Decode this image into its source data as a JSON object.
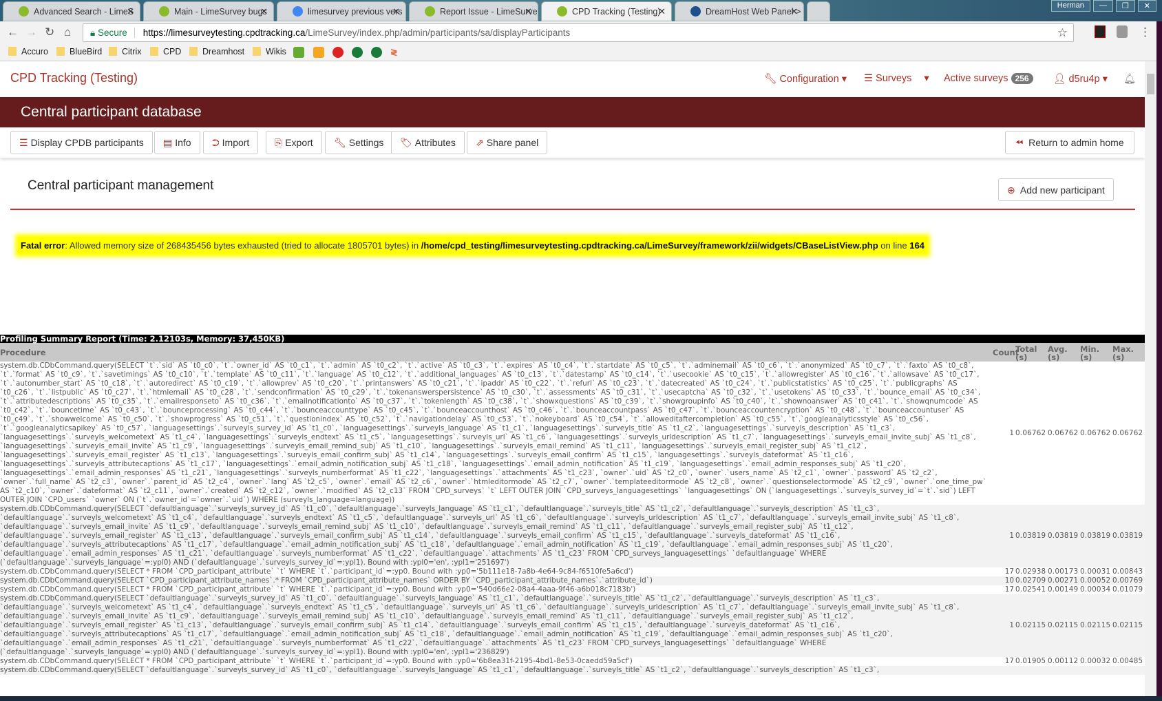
{
  "browser": {
    "tabs": [
      {
        "title": "Advanced Search - LimeS",
        "active": false
      },
      {
        "title": "Main - LimeSurvey bugs",
        "active": false
      },
      {
        "title": "limesurvey previous vers",
        "active": false
      },
      {
        "title": "Report Issue - LimeSurve",
        "active": false
      },
      {
        "title": "CPD Tracking (Testing)",
        "active": true
      },
      {
        "title": "DreamHost Web Panel >",
        "active": false
      }
    ],
    "user": "Herman",
    "secure_label": "Secure",
    "url_host": "https://limesurveytesting.cpdtracking.ca",
    "url_path": "/LimeSurvey/index.php/admin/participants/sa/displayParticipants",
    "bookmarks": [
      "Accuro",
      "BlueBird",
      "Citrix",
      "CPD",
      "Dreamhost",
      "Wikis"
    ]
  },
  "app": {
    "brand": "CPD Tracking (Testing)",
    "nav": {
      "configuration": "Configuration",
      "surveys": "Surveys",
      "active_surveys": "Active surveys",
      "active_count": "256",
      "user": "d5ru4p"
    },
    "banner": "Central participant database",
    "buttons": [
      "Display CPDB participants",
      "Info",
      "Import",
      "Export",
      "Settings",
      "Attributes",
      "Share panel"
    ],
    "return_label": "Return to admin home",
    "section_title": "Central participant management",
    "add_label": "Add new participant",
    "error": {
      "label": "Fatal error",
      "message": ": Allowed memory size of 268435456 bytes exhausted (tried to allocate 1805701 bytes) in ",
      "file": "/home/cpd_testing/limesurveytesting.cpdtracking.ca/LimeSurvey/framework/zii/widgets/CBaseListView.php",
      "on_line": " on line ",
      "line": "164"
    }
  },
  "profiling": {
    "title": "Profiling Summary Report (Time: 2.12103s, Memory: 37,450KB)",
    "headers": [
      "Procedure",
      "Count",
      "Total (s)",
      "Avg. (s)",
      "Min. (s)",
      "Max. (s)"
    ],
    "rows": [
      {
        "procedure": "system.db.CDbCommand.query(SELECT `t`.`sid` AS `t0_c0`, `t`.`owner_id` AS `t0_c1`, `t`.`admin` AS `t0_c2`, `t`.`active` AS `t0_c3`, `t`.`expires` AS `t0_c4`, `t`.`startdate` AS `t0_c5`, `t`.`adminemail` AS `t0_c6`, `t`.`anonymized` AS `t0_c7`, `t`.`faxto` AS `t0_c8`, `t`.`format` AS `t0_c9`, `t`.`savetimings` AS `t0_c10`, `t`.`template` AS `t0_c11`, `t`.`language` AS `t0_c12`, `t`.`additional_languages` AS `t0_c13`, `t`.`datestamp` AS `t0_c14`, `t`.`usecookie` AS `t0_c15`, `t`.`allowregister` AS `t0_c16`, `t`.`allowsave` AS `t0_c17`, `t`.`autonumber_start` AS `t0_c18`, `t`.`autoredirect` AS `t0_c19`, `t`.`allowprev` AS `t0_c20`, `t`.`printanswers` AS `t0_c21`, `t`.`ipaddr` AS `t0_c22`, `t`.`refurl` AS `t0_c23`, `t`.`datecreated` AS `t0_c24`, `t`.`publicstatistics` AS `t0_c25`, `t`.`publicgraphs` AS `t0_c26`, `t`.`listpublic` AS `t0_c27`, `t`.`htmlemail` AS `t0_c28`, `t`.`sendconfirmation` AS `t0_c29`, `t`.`tokenanswerspersistence` AS `t0_c30`, `t`.`assessments` AS `t0_c31`, `t`.`usecaptcha` AS `t0_c32`, `t`.`usetokens` AS `t0_c33`, `t`.`bounce_email` AS `t0_c34`, `t`.`attributedescriptions` AS `t0_c35`, `t`.`emailresponseto` AS `t0_c36`, `t`.`emailnotificationto` AS `t0_c37`, `t`.`tokenlength` AS `t0_c38`, `t`.`showxquestions` AS `t0_c39`, `t`.`showgroupinfo` AS `t0_c40`, `t`.`shownoanswer` AS `t0_c41`, `t`.`showqnumcode` AS `t0_c42`, `t`.`bouncetime` AS `t0_c43`, `t`.`bounceprocessing` AS `t0_c44`, `t`.`bounceaccounttype` AS `t0_c45`, `t`.`bounceaccounthost` AS `t0_c46`, `t`.`bounceaccountpass` AS `t0_c47`, `t`.`bounceaccountencryption` AS `t0_c48`, `t`.`bounceaccountuser` AS `t0_c49`, `t`.`showwelcome` AS `t0_c50`, `t`.`showprogress` AS `t0_c51`, `t`.`questionindex` AS `t0_c52`, `t`.`navigationdelay` AS `t0_c53`, `t`.`nokeyboard` AS `t0_c54`, `t`.`alloweditaftercompletion` AS `t0_c55`, `t`.`googleanalyticsstyle` AS `t0_c56`, `t`.`googleanalyticsapikey` AS `t0_c57`, `languagesettings`.`surveyls_survey_id` AS `t1_c0`, `languagesettings`.`surveyls_language` AS `t1_c1`, `languagesettings`.`surveyls_title` AS `t1_c2`, `languagesettings`.`surveyls_description` AS `t1_c3`, `languagesettings`.`surveyls_welcometext` AS `t1_c4`, `languagesettings`.`surveyls_endtext` AS `t1_c5`, `languagesettings`.`surveyls_url` AS `t1_c6`, `languagesettings`.`surveyls_urldescription` AS `t1_c7`, `languagesettings`.`surveyls_email_invite_subj` AS `t1_c8`, `languagesettings`.`surveyls_email_invite` AS `t1_c9`, `languagesettings`.`surveyls_email_remind_subj` AS `t1_c10`, `languagesettings`.`surveyls_email_remind` AS `t1_c11`, `languagesettings`.`surveyls_email_register_subj` AS `t1_c12`, `languagesettings`.`surveyls_email_register` AS `t1_c13`, `languagesettings`.`surveyls_email_confirm_subj` AS `t1_c14`, `languagesettings`.`surveyls_email_confirm` AS `t1_c15`, `languagesettings`.`surveyls_dateformat` AS `t1_c16`, `languagesettings`.`surveyls_attributecaptions` AS `t1_c17`, `languagesettings`.`email_admin_notification_subj` AS `t1_c18`, `languagesettings`.`email_admin_notification` AS `t1_c19`, `languagesettings`.`email_admin_responses_subj` AS `t1_c20`, `languagesettings`.`email_admin_responses` AS `t1_c21`, `languagesettings`.`surveyls_numberformat` AS `t1_c22`, `languagesettings`.`attachments` AS `t1_c23`, `owner`.`uid` AS `t2_c0`, `owner`.`users_name` AS `t2_c1`, `owner`.`password` AS `t2_c2`, `owner`.`full_name` AS `t2_c3`, `owner`.`parent_id` AS `t2_c4`, `owner`.`lang` AS `t2_c5`, `owner`.`email` AS `t2_c6`, `owner`.`htmleditormode` AS `t2_c7`, `owner`.`templateeditormode` AS `t2_c8`, `owner`.`questionselectormode` AS `t2_c9`, `owner`.`one_time_pw` AS `t2_c10`, `owner`.`dateformat` AS `t2_c11`, `owner`.`created` AS `t2_c12`, `owner`.`modified` AS `t2_c13` FROM `CPD_surveys` `t` LEFT OUTER JOIN `CPD_surveys_languagesettings` `languagesettings` ON (`languagesettings`.`surveyls_survey_id`=`t`.`sid`) LEFT OUTER JOIN `CPD_users` `owner` ON (`t`.`owner_id`=`owner`.`uid`) WHERE (surveyls_language=language))",
        "count": "1",
        "total": "0.06762",
        "avg": "0.06762",
        "min": "0.06762",
        "max": "0.06762"
      },
      {
        "procedure": "system.db.CDbCommand.query(SELECT `defaultlanguage`.`surveyls_survey_id` AS `t1_c0`, `defaultlanguage`.`surveyls_language` AS `t1_c1`, `defaultlanguage`.`surveyls_title` AS `t1_c2`, `defaultlanguage`.`surveyls_description` AS `t1_c3`, `defaultlanguage`.`surveyls_welcometext` AS `t1_c4`, `defaultlanguage`.`surveyls_endtext` AS `t1_c5`, `defaultlanguage`.`surveyls_url` AS `t1_c6`, `defaultlanguage`.`surveyls_urldescription` AS `t1_c7`, `defaultlanguage`.`surveyls_email_invite_subj` AS `t1_c8`, `defaultlanguage`.`surveyls_email_invite` AS `t1_c9`, `defaultlanguage`.`surveyls_email_remind_subj` AS `t1_c10`, `defaultlanguage`.`surveyls_email_remind` AS `t1_c11`, `defaultlanguage`.`surveyls_email_register_subj` AS `t1_c12`, `defaultlanguage`.`surveyls_email_register` AS `t1_c13`, `defaultlanguage`.`surveyls_email_confirm_subj` AS `t1_c14`, `defaultlanguage`.`surveyls_email_confirm` AS `t1_c15`, `defaultlanguage`.`surveyls_dateformat` AS `t1_c16`, `defaultlanguage`.`surveyls_attributecaptions` AS `t1_c17`, `defaultlanguage`.`email_admin_notification_subj` AS `t1_c18`, `defaultlanguage`.`email_admin_notification` AS `t1_c19`, `defaultlanguage`.`email_admin_responses_subj` AS `t1_c20`, `defaultlanguage`.`email_admin_responses` AS `t1_c21`, `defaultlanguage`.`surveyls_numberformat` AS `t1_c22`, `defaultlanguage`.`attachments` AS `t1_c23` FROM `CPD_surveys_languagesettings` `defaultlanguage` WHERE (`defaultlanguage`.`surveyls_language`=:ypl0) AND (`defaultlanguage`.`surveyls_survey_id`=:ypl1). Bound with :ypl0='en', :ypl1='251697')",
        "count": "1",
        "total": "0.03819",
        "avg": "0.03819",
        "min": "0.03819",
        "max": "0.03819"
      },
      {
        "procedure": "system.db.CDbCommand.query(SELECT * FROM `CPD_participant_attribute` `t` WHERE `t`.`participant_id`=:yp0. Bound with :yp0='5b111e18-7a8b-4e64-9c84-f6510fe5a6cd')",
        "count": "17",
        "total": "0.02938",
        "avg": "0.00173",
        "min": "0.00031",
        "max": "0.00843"
      },
      {
        "procedure": "system.db.CDbCommand.query(SELECT `CPD_participant_attribute_names`.* FROM `CPD_participant_attribute_names` ORDER BY `CPD_participant_attribute_names`.`attribute_id`)",
        "count": "10",
        "total": "0.02709",
        "avg": "0.00271",
        "min": "0.00052",
        "max": "0.00769"
      },
      {
        "procedure": "system.db.CDbCommand.query(SELECT * FROM `CPD_participant_attribute` `t` WHERE `t`.`participant_id`=:yp0. Bound with :yp0='540d66e2-08a4-4aaa-9f46-a6b018c7183b')",
        "count": "17",
        "total": "0.02541",
        "avg": "0.00149",
        "min": "0.00034",
        "max": "0.01079"
      },
      {
        "procedure": "system.db.CDbCommand.query(SELECT `defaultlanguage`.`surveyls_survey_id` AS `t1_c0`, `defaultlanguage`.`surveyls_language` AS `t1_c1`, `defaultlanguage`.`surveyls_title` AS `t1_c2`, `defaultlanguage`.`surveyls_description` AS `t1_c3`, `defaultlanguage`.`surveyls_welcometext` AS `t1_c4`, `defaultlanguage`.`surveyls_endtext` AS `t1_c5`, `defaultlanguage`.`surveyls_url` AS `t1_c6`, `defaultlanguage`.`surveyls_urldescription` AS `t1_c7`, `defaultlanguage`.`surveyls_email_invite_subj` AS `t1_c8`, `defaultlanguage`.`surveyls_email_invite` AS `t1_c9`, `defaultlanguage`.`surveyls_email_remind_subj` AS `t1_c10`, `defaultlanguage`.`surveyls_email_remind` AS `t1_c11`, `defaultlanguage`.`surveyls_email_register_subj` AS `t1_c12`, `defaultlanguage`.`surveyls_email_register` AS `t1_c13`, `defaultlanguage`.`surveyls_email_confirm_subj` AS `t1_c14`, `defaultlanguage`.`surveyls_email_confirm` AS `t1_c15`, `defaultlanguage`.`surveyls_dateformat` AS `t1_c16`, `defaultlanguage`.`surveyls_attributecaptions` AS `t1_c17`, `defaultlanguage`.`email_admin_notification_subj` AS `t1_c18`, `defaultlanguage`.`email_admin_notification` AS `t1_c19`, `defaultlanguage`.`email_admin_responses_subj` AS `t1_c20`, `defaultlanguage`.`email_admin_responses` AS `t1_c21`, `defaultlanguage`.`surveyls_numberformat` AS `t1_c22`, `defaultlanguage`.`attachments` AS `t1_c23` FROM `CPD_surveys_languagesettings` `defaultlanguage` WHERE (`defaultlanguage`.`surveyls_language`=:ypl0) AND (`defaultlanguage`.`surveyls_survey_id`=:ypl1). Bound with :ypl0='en', :ypl1='236829')",
        "count": "1",
        "total": "0.02115",
        "avg": "0.02115",
        "min": "0.02115",
        "max": "0.02115"
      },
      {
        "procedure": "system.db.CDbCommand.query(SELECT * FROM `CPD_participant_attribute` `t` WHERE `t`.`participant_id`=:yp0. Bound with :yp0='6b8ea31f-2195-4bd1-8e53-0caedd59a5cf')",
        "count": "17",
        "total": "0.01905",
        "avg": "0.00112",
        "min": "0.00032",
        "max": "0.00485"
      },
      {
        "procedure": "system.db.CDbCommand.query(SELECT `defaultlanguage`.`surveyls_survey_id` AS `t1_c0`, `defaultlanguage`.`surveyls_language` AS `t1_c1`, `defaultlanguage`.`surveyls_title` AS `t1_c2`, `defaultlanguage`.`surveyls_description` AS `t1_c3`,",
        "count": "",
        "total": "",
        "avg": "",
        "min": "",
        "max": ""
      }
    ]
  }
}
